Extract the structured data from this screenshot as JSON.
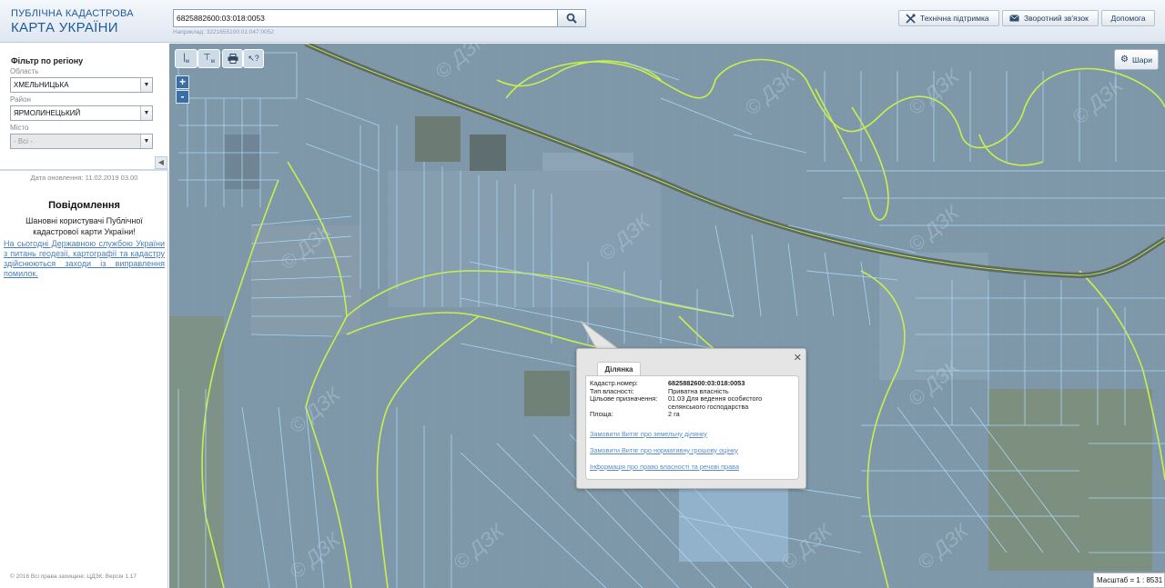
{
  "header": {
    "logo_line1": "ПУБЛІЧНА КАДАСТРОВА",
    "logo_line2": "КАРТА УКРАЇНИ",
    "search_value": "6825882600:03:018:0053",
    "search_hint": "Наприклад: 3221655100:01:047:0052",
    "buttons": {
      "support": "Технічна підтримка",
      "feedback": "Зворотний зв'язок",
      "help": "Допомога"
    }
  },
  "sidebar": {
    "filter_title": "Фільтр по регіону",
    "oblast_label": "Область",
    "oblast_value": "ХМЕЛЬНИЦЬКА",
    "rayon_label": "Район",
    "rayon_value": "ЯРМОЛИНЕЦЬКИЙ",
    "city_label": "Місто",
    "city_value": "- Всі -",
    "update_date": "Дата оновлення: 11.02.2019 03.00",
    "notice_title": "Повідомлення",
    "notice_text": "Шановні користувачі Публічної кадастрової карти України!",
    "notice_link": "На сьогодні Державною службою України з питань геодезії, картографії та кадастру здійснюються заходи із виправлення помилок.",
    "footer": "© 2016 Всі права захищені. ЦДЗК. Версія 1.17"
  },
  "map": {
    "layers_label": "Шари",
    "zoom_in": "+",
    "zoom_out": "-",
    "scale_text": "Масштаб = 1 : 8531",
    "watermark": "© ДЗК",
    "colors": {
      "parcel_line": "#a9d6f5",
      "boundary_line": "#c9f04a",
      "map_base": "#7e97a8"
    }
  },
  "popup": {
    "tab_label": "Ділянка",
    "rows": [
      {
        "key": "Кадастр.номер:",
        "value": "6825882600:03:018:0053"
      },
      {
        "key": "Тип власності:",
        "value": "Приватна власність"
      },
      {
        "key": "Цільове призначення:",
        "value": "01.03 Для ведення особистого селянського господарства"
      },
      {
        "key": "Площа:",
        "value": "2 га"
      }
    ],
    "links": [
      "Замовити Витяг про земельну ділянку",
      "Замовити Витяг про нормативну грошову оцінку",
      "Інформація про право власності та речові права"
    ]
  }
}
